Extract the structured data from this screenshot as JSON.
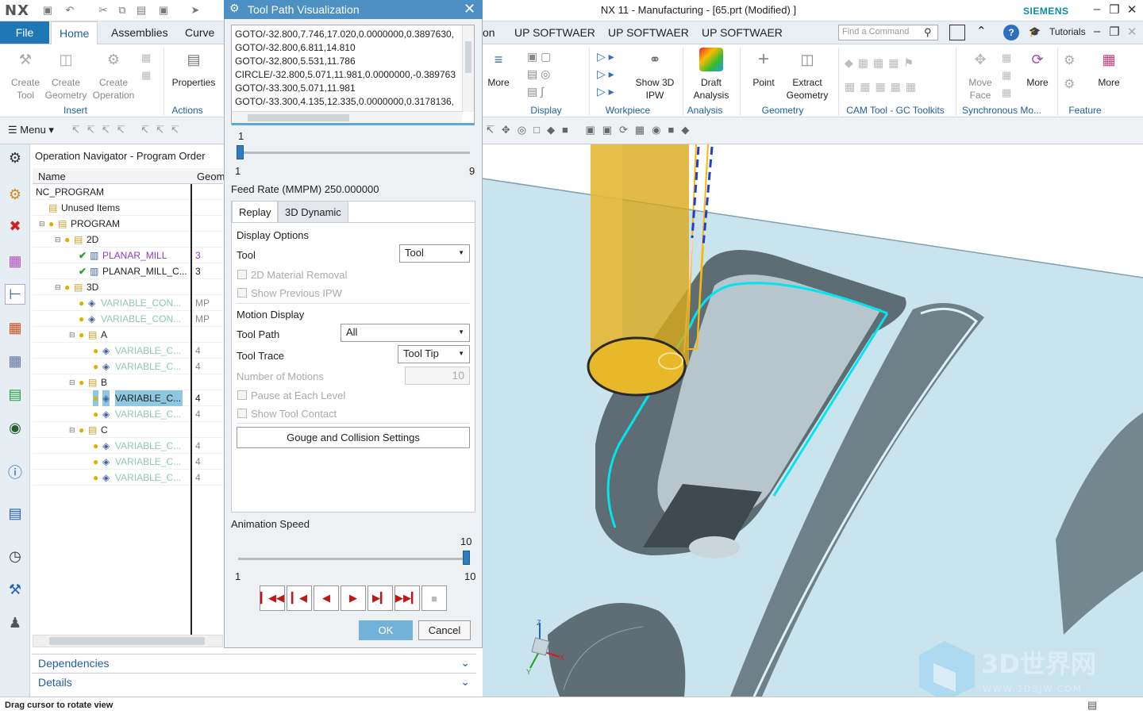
{
  "app": {
    "logo": "NX",
    "window_title": "NX 11 - Manufacturing - [65.prt (Modified) ]",
    "brand": "SIEMENS"
  },
  "ribbon": {
    "file_tab": "File",
    "tabs": [
      "Home",
      "Assemblies",
      "Curve",
      "on",
      "UP SOFTWAER",
      "UP SOFTWAER",
      "UP SOFTWAER"
    ],
    "find_placeholder": "Find a Command",
    "tutorials": "Tutorials",
    "buttons": {
      "create_tool": "Create Tool",
      "create_geometry": "Create Geometry",
      "create_operation": "Create Operation",
      "properties": "Properties",
      "more1": "More",
      "show_ipw": "Show 3D IPW",
      "draft_analysis": "Draft Analysis",
      "point": "Point",
      "extract_geometry": "Extract Geometry",
      "move_face": "Move Face",
      "more2": "More",
      "more3": "More"
    },
    "groups": {
      "insert": "Insert",
      "actions": "Actions",
      "display": "Display",
      "workpiece": "Workpiece",
      "analysis": "Analysis",
      "geometry": "Geometry",
      "cam_tool": "CAM Tool - GC Toolkits",
      "sync": "Synchronous Mo...",
      "feature": "Feature"
    }
  },
  "toolbar": {
    "menu": "Menu"
  },
  "navigator": {
    "title": "Operation Navigator - Program Order",
    "col_name": "Name",
    "col_geom": "Geom",
    "rows": [
      {
        "name": "NC_PROGRAM",
        "geom": ""
      },
      {
        "name": "Unused Items",
        "geom": ""
      },
      {
        "name": "PROGRAM",
        "geom": ""
      },
      {
        "name": "2D",
        "geom": ""
      },
      {
        "name": "PLANAR_MILL",
        "geom": "3"
      },
      {
        "name": "PLANAR_MILL_C...",
        "geom": "3"
      },
      {
        "name": "3D",
        "geom": ""
      },
      {
        "name": "VARIABLE_CON...",
        "geom": "MP"
      },
      {
        "name": "VARIABLE_CON...",
        "geom": "MP"
      },
      {
        "name": "A",
        "geom": ""
      },
      {
        "name": "VARIABLE_C...",
        "geom": "4"
      },
      {
        "name": "VARIABLE_C...",
        "geom": "4"
      },
      {
        "name": "B",
        "geom": ""
      },
      {
        "name": "VARIABLE_C...",
        "geom": "4"
      },
      {
        "name": "VARIABLE_C...",
        "geom": "4"
      },
      {
        "name": "C",
        "geom": ""
      },
      {
        "name": "VARIABLE_C...",
        "geom": "4"
      },
      {
        "name": "VARIABLE_C...",
        "geom": "4"
      },
      {
        "name": "VARIABLE_C...",
        "geom": "4"
      }
    ],
    "dependencies": "Dependencies",
    "details": "Details"
  },
  "dialog": {
    "title": "Tool Path Visualization",
    "cl_lines": [
      "GOTO/-32.800,7.746,17.020,0.0000000,0.3897630,",
      "GOTO/-32.800,6.811,14.810",
      "GOTO/-32.800,5.531,11.786",
      "CIRCLE/-32.800,5.071,11.981,0.0000000,-0.389763",
      "GOTO/-33.300,5.071,11.981",
      "GOTO/-33.300,4.135,12.335,0.0000000,0.3178136,"
    ],
    "motion_value": "1",
    "motion_min": "1",
    "motion_max": "9",
    "feed_rate": "Feed Rate (MMPM) 250.000000",
    "tab_replay": "Replay",
    "tab_3d": "3D Dynamic",
    "display_options": "Display Options",
    "tool_label": "Tool",
    "tool_value": "Tool",
    "material_removal": "2D Material Removal",
    "show_prev_ipw": "Show Previous IPW",
    "motion_display": "Motion Display",
    "tool_path_label": "Tool Path",
    "tool_path_value": "All",
    "tool_trace_label": "Tool Trace",
    "tool_trace_value": "Tool Tip",
    "num_motions_label": "Number of Motions",
    "num_motions_value": "10",
    "pause_each_level": "Pause at Each Level",
    "show_tool_contact": "Show Tool Contact",
    "gouge_button": "Gouge and Collision Settings",
    "anim_speed": "Animation Speed",
    "speed_value": "10",
    "speed_min": "1",
    "speed_max": "10",
    "ok": "OK",
    "cancel": "Cancel"
  },
  "status": "Drag cursor to rotate view",
  "watermark": {
    "text": "3D世界网",
    "url": "WWW.3DSJW.COM"
  },
  "colors": {
    "accent": "#1f77b5",
    "title": "#4d90c4",
    "selection": "#8ec8e0",
    "toolpath": "#00e5f0",
    "tool": "#e0b020"
  }
}
